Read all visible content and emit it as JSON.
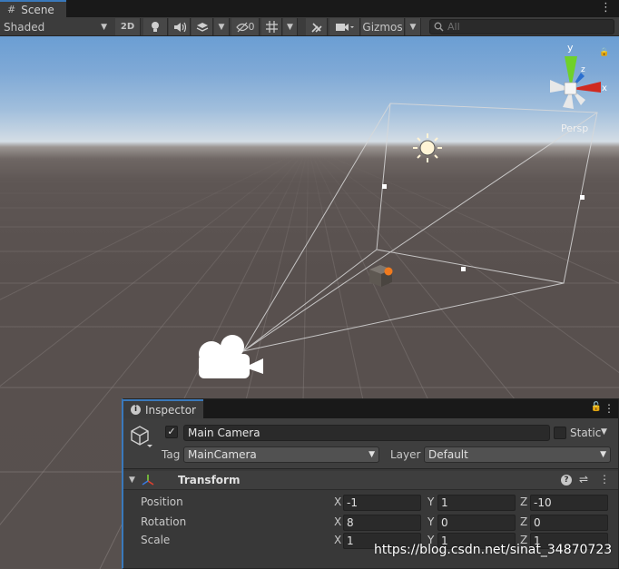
{
  "tab": {
    "title": "Scene",
    "menu_glyph": "⋮"
  },
  "toolbar": {
    "shading_mode": "Shaded",
    "mode_2d": "2D",
    "hidden_count": "0",
    "gizmos_label": "Gizmos",
    "search_placeholder": "All"
  },
  "scene": {
    "projection_label": "Persp",
    "axis_labels": {
      "x": "x",
      "y": "y",
      "z": "z"
    },
    "colors": {
      "sky": "#7fa9d6",
      "horizon": "#d4dde5",
      "ground": "#57504e",
      "frustum": "#d9d9d9"
    }
  },
  "inspector": {
    "tab_title": "Inspector",
    "object": {
      "active": true,
      "name": "Main Camera",
      "static_label": "Static",
      "tag_label": "Tag",
      "tag_value": "MainCamera",
      "layer_label": "Layer",
      "layer_value": "Default"
    },
    "transform": {
      "title": "Transform",
      "rows": [
        {
          "label": "Position",
          "x": "-1",
          "y": "1",
          "z": "-10"
        },
        {
          "label": "Rotation",
          "x": "8",
          "y": "0",
          "z": "0"
        },
        {
          "label": "Scale",
          "x": "1",
          "y": "1",
          "z": "1"
        }
      ],
      "axis_names": {
        "x": "X",
        "y": "Y",
        "z": "Z"
      }
    }
  },
  "watermark": "https://blog.csdn.net/sinat_34870723"
}
